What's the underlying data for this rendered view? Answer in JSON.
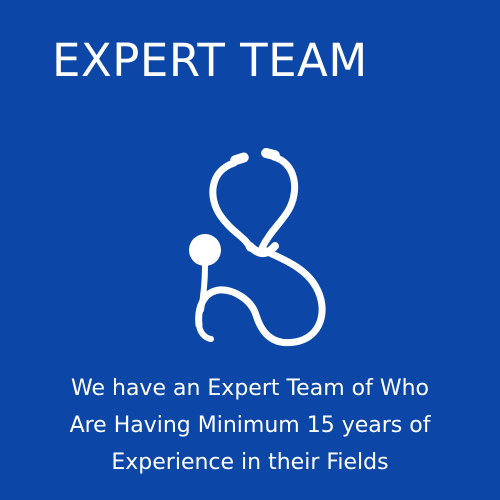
{
  "card": {
    "title": "EXPERT TEAM",
    "icon": "stethoscope-icon",
    "description_lines": [
      "We have an Expert Team of Who",
      "Are Having Minimum 15 years of",
      "Experience in their Fields"
    ]
  },
  "colors": {
    "background": "#0c47a8",
    "text": "#ffffff"
  }
}
